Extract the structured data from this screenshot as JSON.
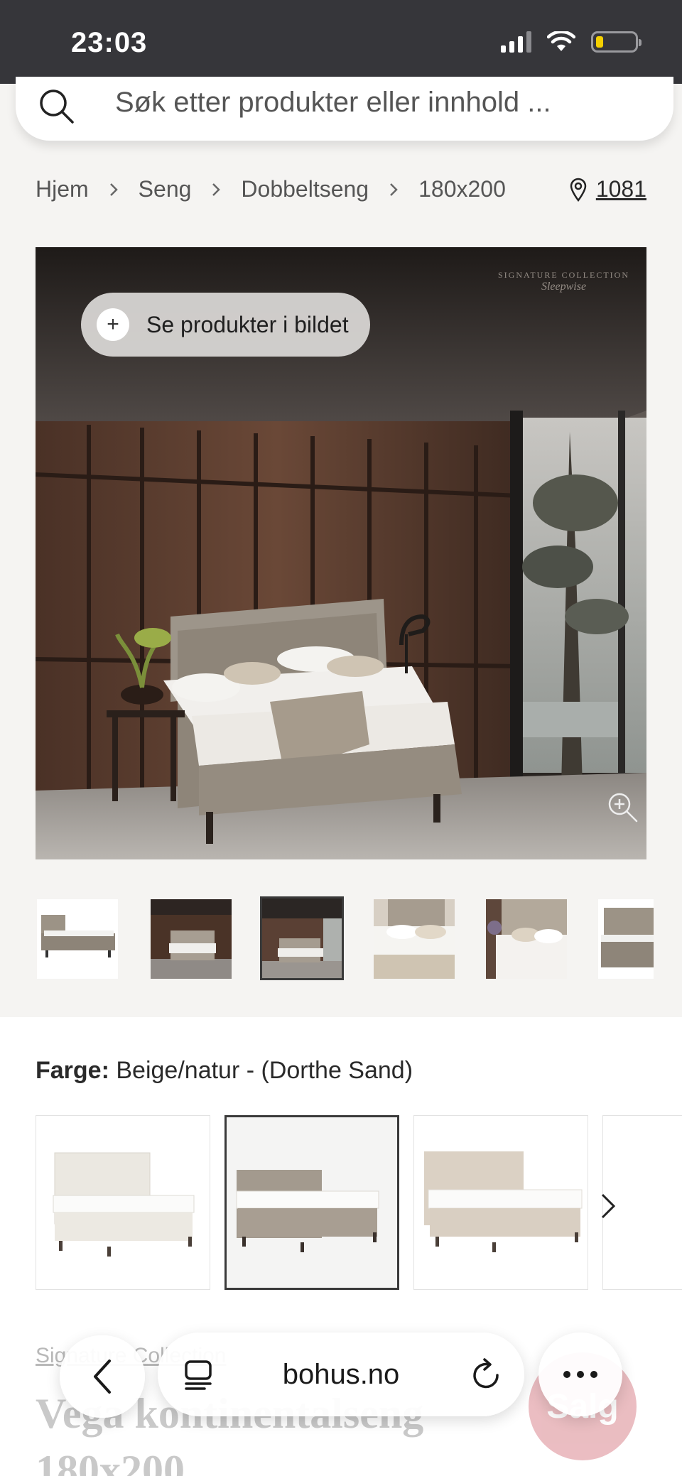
{
  "status_bar": {
    "time": "23:03"
  },
  "search": {
    "placeholder": "Søk etter produkter eller innhold ..."
  },
  "breadcrumb": {
    "items": [
      "Hjem",
      "Seng",
      "Dobbeltseng",
      "180x200"
    ]
  },
  "location": {
    "zip": "1081"
  },
  "hero": {
    "see_products_label": "Se produkter i bildet",
    "watermark_line1": "SIGNATURE COLLECTION",
    "watermark_line2": "Sleepwise"
  },
  "gallery": {
    "thumbnail_count": 6,
    "selected_index": 2
  },
  "color": {
    "label": "Farge:",
    "value": "Beige/natur - (Dorthe Sand)",
    "swatch_colors": [
      "#ece9e2",
      "#a89e92",
      "#d9cfc2"
    ],
    "selected_index": 1
  },
  "product": {
    "collection": "Signature Collection",
    "title": "Vega kontinentalseng 180x200",
    "badge": "Salg"
  },
  "browser": {
    "url": "bohus.no"
  }
}
